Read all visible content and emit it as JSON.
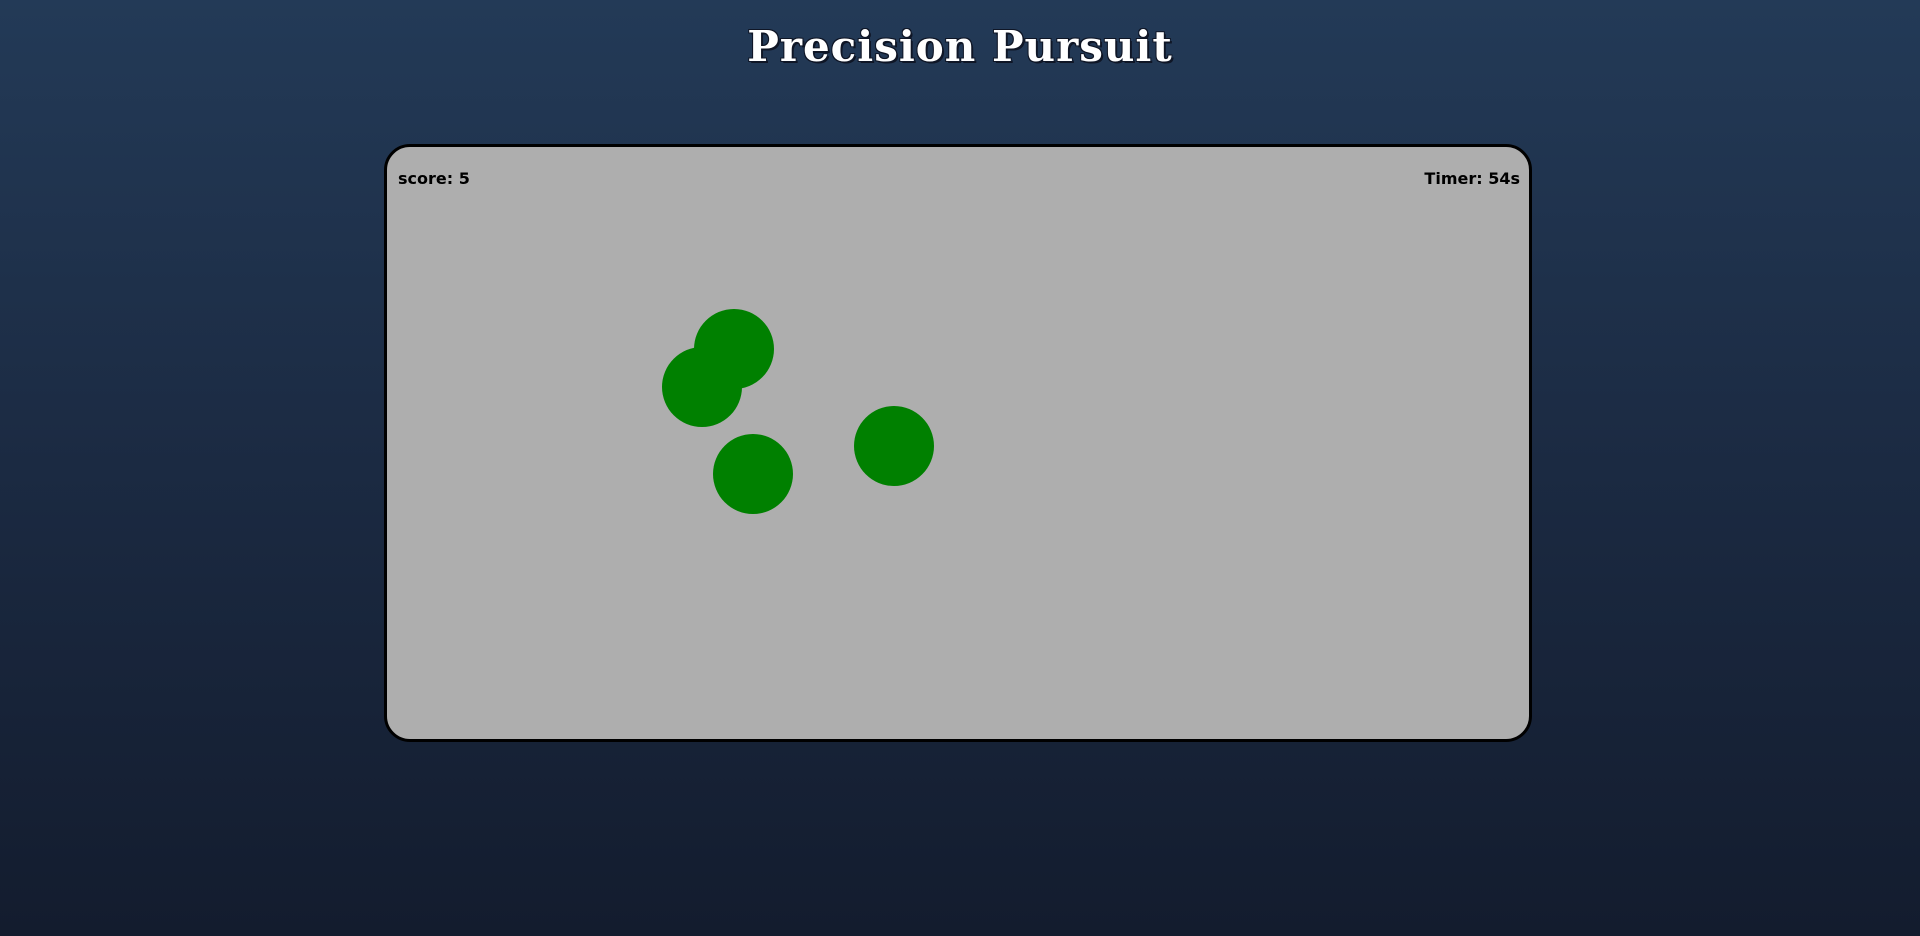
{
  "title": "Precision Pursuit",
  "hud": {
    "score": "score: 5",
    "timer": "Timer: 54s"
  },
  "colors": {
    "target": "#008000",
    "game_background": "#aeaeae"
  },
  "targets": [
    {
      "name": "target-circle-1"
    },
    {
      "name": "target-circle-2"
    },
    {
      "name": "target-circle-3"
    },
    {
      "name": "target-circle-4"
    }
  ]
}
